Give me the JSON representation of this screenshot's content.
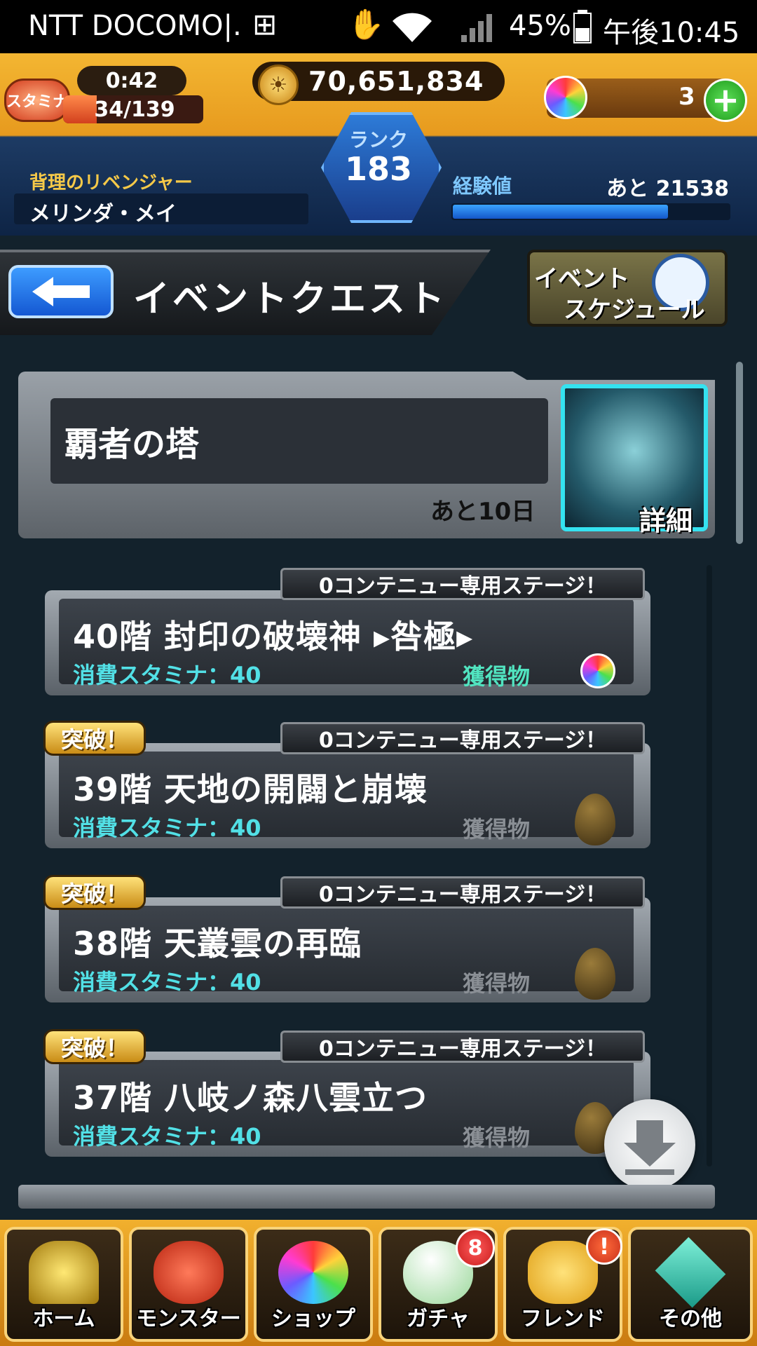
{
  "status_bar": {
    "carrier": "NTT DOCOMO|.",
    "battery": "45%",
    "time": "午後10:45"
  },
  "header": {
    "stamina_badge": "スタミナ",
    "stamina_timer": "0:42",
    "stamina_count": "34/139",
    "stamina_fraction": 0.24,
    "gold": "70,651,834",
    "orbs": "3",
    "rank_label": "ランク",
    "rank": "183",
    "title": "背理のリベンジャー",
    "name": "メリンダ・メイ",
    "exp_label": "経験値",
    "exp_remaining": "あと 21538",
    "exp_fraction": 0.78
  },
  "title_bar": {
    "title": "イベントクエスト",
    "schedule_line1": "イベント",
    "schedule_line2": "スケジュール"
  },
  "event": {
    "name": "覇者の塔",
    "remaining": "あと10日",
    "detail": "詳細"
  },
  "quests": [
    {
      "tag": "0コンテニュー専用ステージ！",
      "name": "40階 封印の破壊神 ▸咎極▸",
      "stamina": "消費スタミナ：40",
      "reward_label": "獲得物",
      "reward": "orb",
      "cleared": false
    },
    {
      "tag": "0コンテニュー専用ステージ！",
      "name": "39階 天地の開闢と崩壊",
      "stamina": "消費スタミナ：40",
      "reward_label": "獲得物",
      "reward": "egg",
      "cleared": true
    },
    {
      "tag": "0コンテニュー専用ステージ！",
      "name": "38階 天叢雲の再臨",
      "stamina": "消費スタミナ：40",
      "reward_label": "獲得物",
      "reward": "egg",
      "cleared": true
    },
    {
      "tag": "0コンテニュー専用ステージ！",
      "name": "37階 八岐ノ森八雲立つ",
      "stamina": "消費スタミナ：40",
      "reward_label": "獲得物",
      "reward": "egg",
      "cleared": true
    }
  ],
  "cleared_label": "突破！",
  "nav": {
    "home": "ホーム",
    "monster": "モンスター",
    "shop": "ショップ",
    "gacha": "ガチャ",
    "gacha_badge": "8",
    "friend": "フレンド",
    "friend_badge": "!",
    "other": "その他"
  },
  "icons": {
    "back": "back-arrow-icon",
    "download": "download-arrow-icon",
    "gold": "gold-coin-icon",
    "orb": "rainbow-orb-icon",
    "add": "plus-icon"
  }
}
